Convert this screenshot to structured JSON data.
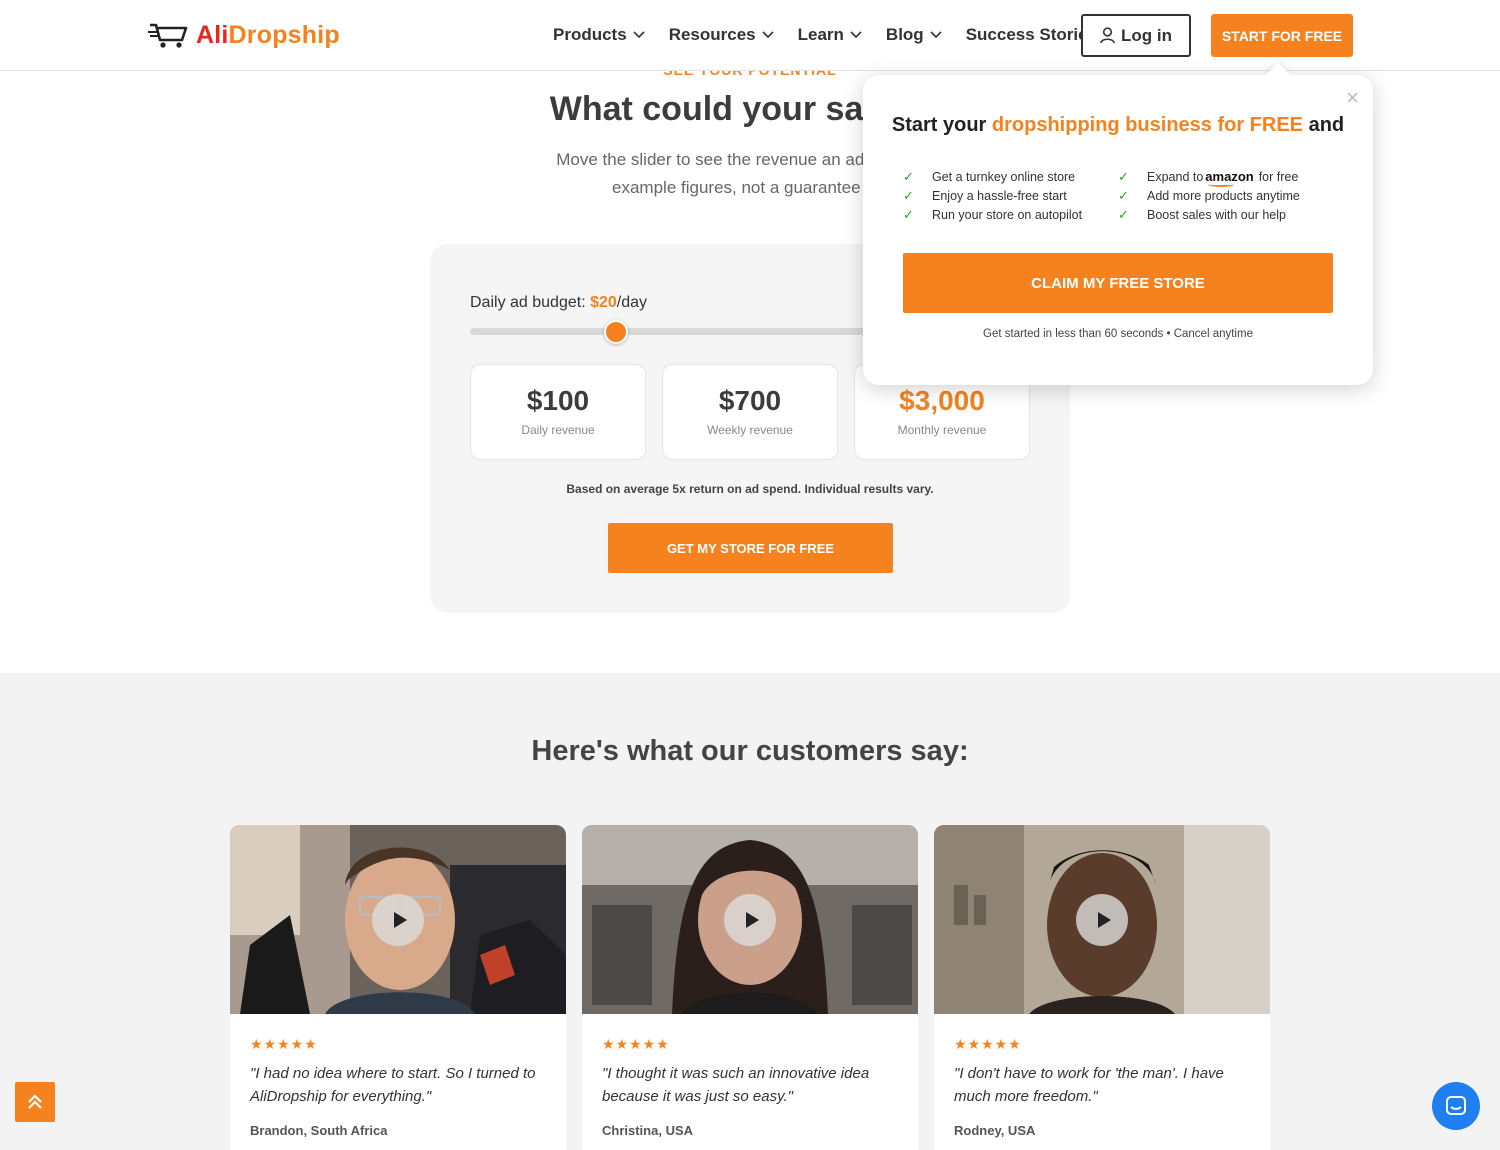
{
  "header": {
    "logo": {
      "part1": "Ali",
      "part2": "Dropship"
    },
    "nav": [
      {
        "label": "Products",
        "has_dropdown": true
      },
      {
        "label": "Resources",
        "has_dropdown": true
      },
      {
        "label": "Learn",
        "has_dropdown": true
      },
      {
        "label": "Blog",
        "has_dropdown": true
      },
      {
        "label": "Success Stories",
        "has_dropdown": false
      }
    ],
    "login_label": "Log in",
    "start_label": "START FOR FREE"
  },
  "hero": {
    "eyebrow": "SEE YOUR POTENTIAL",
    "title": "What could your sales lo",
    "subtitle_line1": "Move the slider to see the revenue an ad budget co",
    "subtitle_line2": "example figures, not a guarantee of i"
  },
  "calculator": {
    "budget_prefix": "Daily ad budget: ",
    "budget_value": "$20",
    "budget_suffix": "/day",
    "slider_level_fraction": 0.26,
    "daily": {
      "value": "$100",
      "label": "Daily revenue"
    },
    "weekly": {
      "value": "$700",
      "label": "Weekly revenue"
    },
    "monthly": {
      "value": "$3,000",
      "label": "Monthly revenue"
    },
    "disclaimer": "Based on average 5x return on ad spend. Individual results vary.",
    "cta": "GET MY STORE FOR FREE"
  },
  "testimonials": {
    "title": "Here's what our customers say:",
    "items": [
      {
        "stars": "★★★★★",
        "rating": 5,
        "quote_line1": "\"I had no idea where to start. So I turned to",
        "quote_line2": "AliDropship for everything.\"",
        "author": "Brandon, South Africa"
      },
      {
        "stars": "★★★★★",
        "rating": 5,
        "quote_line1": "\"I thought it was such an innovative idea",
        "quote_line2": "because it was just so easy.\"",
        "author": "Christina, USA"
      },
      {
        "stars": "★★★★★",
        "rating": 5,
        "quote_line1": "\"I don't have to work for 'the man'. I have",
        "quote_line2": "much more freedom.\"",
        "author": "Rodney, USA"
      }
    ]
  },
  "popup": {
    "close": "×",
    "title_start": "Start your ",
    "title_highlight": "dropshipping business for FREE",
    "title_end": " and",
    "benefits_left": [
      "Get a turnkey online store",
      "Enjoy a hassle-free start",
      "Run your store on autopilot"
    ],
    "benefits_right_first_prefix": "Expand to",
    "benefits_right_first_brand": "amazon",
    "benefits_right_first_suffix": "for free",
    "benefits_right": [
      "Add more products anytime",
      "Boost sales with our help"
    ],
    "cta": "CLAIM MY FREE STORE",
    "footer": "Get started in less than 60 seconds • Cancel anytime"
  },
  "colors": {
    "accent": "#f5821f",
    "logo_red": "#e8261f",
    "check": "#2a9d2a",
    "chat": "#1f7ef0"
  },
  "icons": [
    "cart-logo-icon",
    "chevron-down-icon",
    "user-icon",
    "check-icon",
    "play-icon",
    "close-icon",
    "scroll-up-icon",
    "chat-icon",
    "star-icon"
  ]
}
